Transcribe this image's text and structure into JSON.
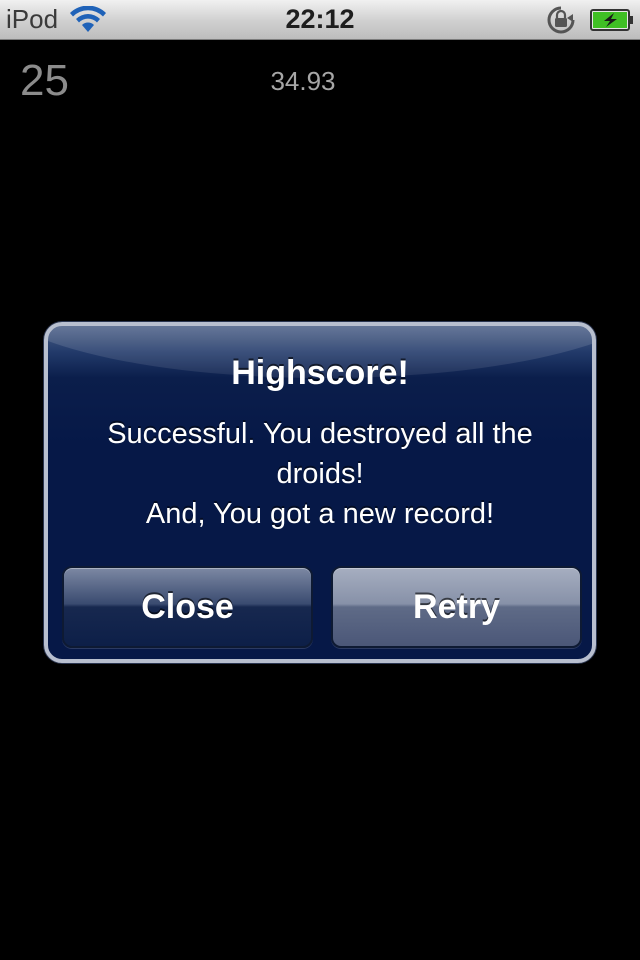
{
  "status_bar": {
    "device": "iPod",
    "time": "22:12",
    "wifi_icon": "wifi-icon",
    "lock_icon": "orientation-lock-icon",
    "battery_icon": "battery-charging-icon",
    "battery_color": "#3fbf24"
  },
  "hud": {
    "score": "25",
    "timer": "34.93"
  },
  "alert": {
    "title": "Highscore!",
    "message_lines": [
      "Successful. You destroyed all the",
      "droids!",
      "And, You got a new record!"
    ],
    "buttons": {
      "close": "Close",
      "retry": "Retry"
    },
    "accent": "#061847"
  }
}
